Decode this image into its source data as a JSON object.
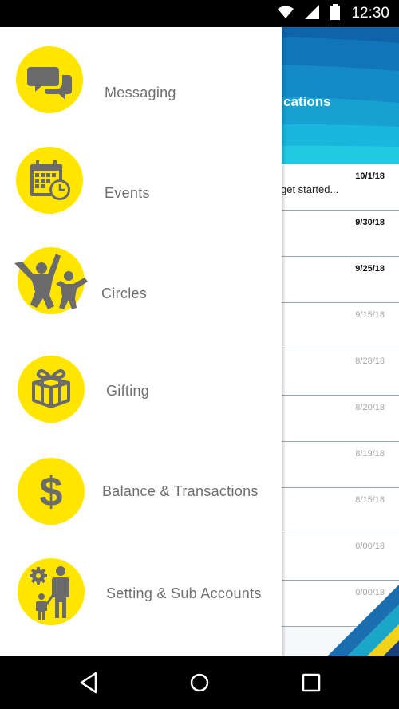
{
  "status_bar": {
    "time": "12:30",
    "icons": [
      "wifi-icon",
      "signal-icon",
      "battery-icon"
    ]
  },
  "background": {
    "header_title_fragment": "ifications",
    "rows": [
      {
        "date": "10/1/18",
        "unread": true,
        "snippet": "get started..."
      },
      {
        "date": "9/30/18",
        "unread": true,
        "snippet": ""
      },
      {
        "date": "9/25/18",
        "unread": true,
        "snippet": ""
      },
      {
        "date": "9/15/18",
        "unread": false,
        "snippet": ""
      },
      {
        "date": "8/28/18",
        "unread": false,
        "snippet": ""
      },
      {
        "date": "8/20/18",
        "unread": false,
        "snippet": ""
      },
      {
        "date": "8/19/18",
        "unread": false,
        "snippet": ""
      },
      {
        "date": "8/15/18",
        "unread": false,
        "snippet": ""
      },
      {
        "date": "0/00/18",
        "unread": false,
        "snippet": ""
      },
      {
        "date": "0/00/18",
        "unread": false,
        "snippet": ""
      }
    ]
  },
  "drawer": {
    "accent_color": "#FFE500",
    "icon_color": "#6b6b6b",
    "items": [
      {
        "label": "Messaging",
        "icon": "chat-bubbles-icon"
      },
      {
        "label": "Events",
        "icon": "calendar-clock-icon"
      },
      {
        "label": "Circles",
        "icon": "people-jumping-icon"
      },
      {
        "label": "Gifting",
        "icon": "gift-box-icon"
      },
      {
        "label": "Balance & Transactions",
        "icon": "dollar-sign-icon"
      },
      {
        "label": "Setting & Sub Accounts",
        "icon": "gear-parent-child-icon"
      }
    ]
  },
  "nav_bar": {
    "buttons": [
      "back-icon",
      "home-icon",
      "recents-icon"
    ]
  }
}
